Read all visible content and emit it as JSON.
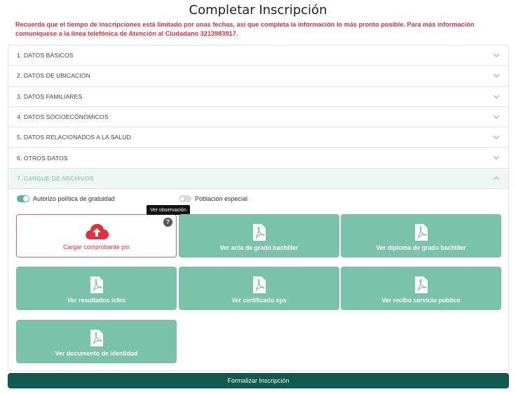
{
  "page": {
    "title": "Completar Inscripción",
    "notice_line1": "Recuerda que el tiempo de inscripciones está limitado por unas fechas, así que completa la información lo más pronto posible. Para más información",
    "notice_line2": "comuníquese a la línea telefónica de Atención al Ciudadano 3213983917."
  },
  "sections": [
    {
      "label": "1. DATOS BÁSICOS",
      "state": "collapsed"
    },
    {
      "label": "2. DATOS DE UBICACIÓN",
      "state": "collapsed"
    },
    {
      "label": "3. DATOS FAMILIARES",
      "state": "collapsed"
    },
    {
      "label": "4. DATOS SOCIOECÓNOMICOS",
      "state": "collapsed"
    },
    {
      "label": "5. DATOS RELACIONADOS A LA SALUD",
      "state": "collapsed"
    },
    {
      "label": "6. OTROS DATOS",
      "state": "collapsed"
    },
    {
      "label": "7. CARGUE DE ARCHIVOS",
      "state": "expanded"
    }
  ],
  "toggles": {
    "gratuidad": {
      "label": "Autorizo política de gratuidad",
      "on": true
    },
    "especial": {
      "label": "Población especial",
      "on": false
    }
  },
  "tooltip": "Ver observación",
  "files": {
    "upload": {
      "label": "Cargar comprobante pin",
      "icon": "cloud-upload-icon"
    },
    "acta": {
      "label": "Ver acta de grado bachiller",
      "icon": "pdf-icon"
    },
    "diploma": {
      "label": "Ver diploma de grado bachiller",
      "icon": "pdf-icon"
    },
    "icfes": {
      "label": "Ver resultados icfes",
      "icon": "pdf-icon"
    },
    "eps": {
      "label": "Ver certificado eps",
      "icon": "pdf-icon"
    },
    "recibo": {
      "label": "Ver recibo servicio publico",
      "icon": "pdf-icon"
    },
    "identidad": {
      "label": "Ver documento de identidad",
      "icon": "pdf-icon"
    }
  },
  "submit_label": "Formalizar Inscripción",
  "colors": {
    "accent_green": "#7bc2ab",
    "dark_green": "#0f5a4f",
    "warning_red": "#e0313c"
  }
}
